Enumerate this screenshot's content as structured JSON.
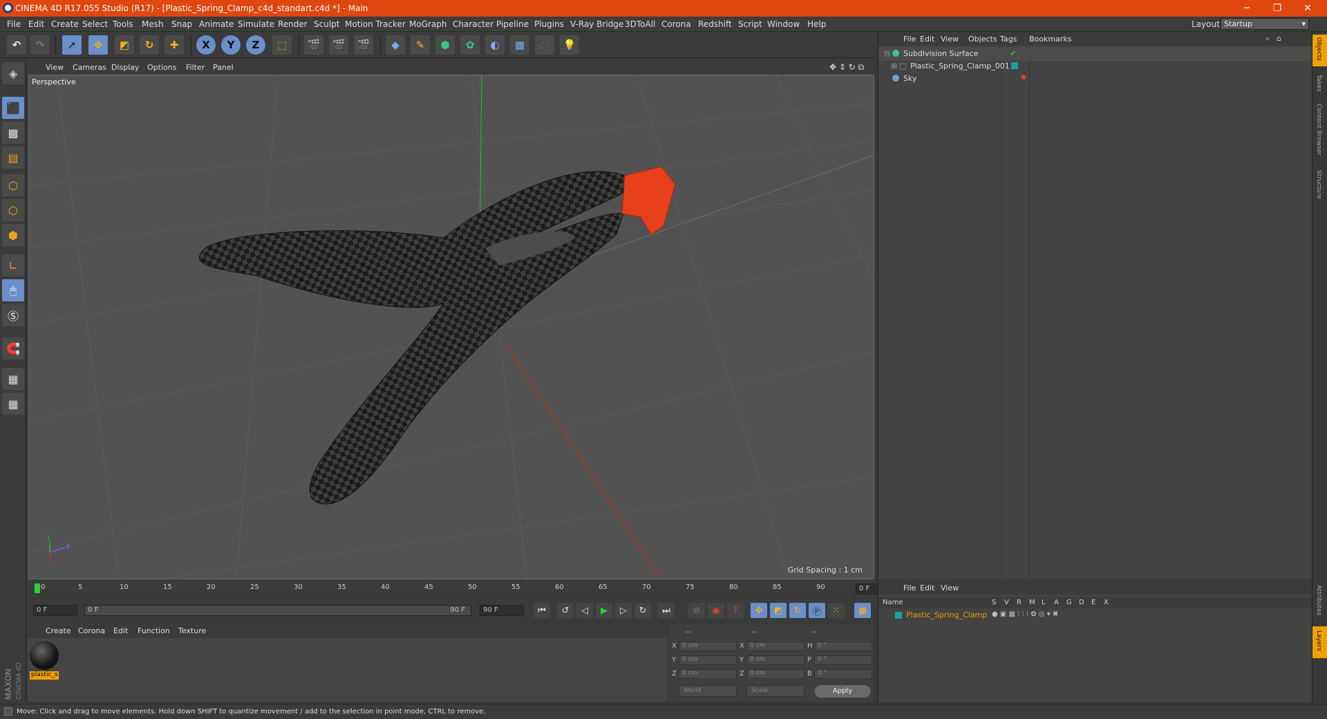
{
  "window": {
    "title": "CINEMA 4D R17.055 Studio (R17) - [Plastic_Spring_Clamp_c4d_standart.c4d *] - Main",
    "min_label": "─",
    "max_label": "❐",
    "close_label": "✕"
  },
  "menubar": {
    "items": [
      "File",
      "Edit",
      "Create",
      "Select",
      "Tools",
      "Mesh",
      "Snap",
      "Animate",
      "Simulate",
      "Render",
      "Sculpt",
      "Motion Tracker",
      "MoGraph",
      "Character",
      "Pipeline",
      "Plugins",
      "V-Ray Bridge",
      "3DToAll",
      "Corona",
      "Redshift",
      "Script",
      "Window",
      "Help"
    ],
    "layout_label": "Layout:",
    "layout_value": "Startup"
  },
  "toolbar": {
    "axis_x": "X",
    "axis_y": "Y",
    "axis_z": "Z"
  },
  "viewport": {
    "menu": [
      "View",
      "Cameras",
      "Display",
      "Options",
      "Filter",
      "Panel"
    ],
    "camera_label": "Perspective",
    "grid_spacing": "Grid Spacing : 1 cm",
    "axis_labels": {
      "x": "x",
      "y": "y",
      "z": "z"
    }
  },
  "timeline": {
    "ticks": [
      "0",
      "5",
      "10",
      "15",
      "20",
      "25",
      "30",
      "35",
      "40",
      "45",
      "50",
      "55",
      "60",
      "65",
      "70",
      "75",
      "80",
      "85",
      "90"
    ],
    "current_frame": "0 F",
    "start_frame": "0 F",
    "range_start": "0 F",
    "range_end": "90 F",
    "end_frame": "90 F"
  },
  "material_manager": {
    "menu": [
      "Create",
      "Corona",
      "Edit",
      "Function",
      "Texture"
    ],
    "materials": [
      {
        "name": "plastic_s"
      }
    ]
  },
  "coordinates": {
    "headers": [
      "--",
      "--",
      "--"
    ],
    "rows": [
      {
        "l1": "X",
        "v1": "0 cm",
        "l2": "X",
        "v2": "0 cm",
        "l3": "H",
        "v3": "0 °"
      },
      {
        "l1": "Y",
        "v1": "0 cm",
        "l2": "Y",
        "v2": "0 cm",
        "l3": "P",
        "v3": "0 °"
      },
      {
        "l1": "Z",
        "v1": "0 cm",
        "l2": "Z",
        "v2": "0 cm",
        "l3": "B",
        "v3": "0 °"
      }
    ],
    "mode": "World",
    "size_mode": "Scale",
    "apply_label": "Apply"
  },
  "object_manager": {
    "menu": [
      "File",
      "Edit",
      "View",
      "Objects",
      "Tags",
      "Bookmarks"
    ],
    "objects": [
      {
        "name": "Subdivision Surface",
        "color": "#3ec58a"
      },
      {
        "name": "Plastic_Spring_Clamp_001",
        "color": "#cccccc"
      },
      {
        "name": "Sky",
        "color": "#6fa0d8"
      }
    ]
  },
  "layer_manager": {
    "menu": [
      "File",
      "Edit",
      "View"
    ],
    "header_name": "Name",
    "header_cols": [
      "S",
      "V",
      "R",
      "M",
      "L",
      "A",
      "G",
      "D",
      "E",
      "X"
    ],
    "layers": [
      {
        "name": "Plastic_Spring_Clamp",
        "color": "#1aa0a0"
      }
    ]
  },
  "right_tabs": [
    "Objects",
    "Takes",
    "Content Browser",
    "Structure",
    "Attributes",
    "Layers"
  ],
  "brand": {
    "line1": "MAXON",
    "line2": "CINEMA 4D"
  },
  "status": "Move: Click and drag to move elements. Hold down SHIFT to quantize movement / add to the selection in point mode, CTRL to remove.",
  "colors": {
    "titlebar": "#e0460f",
    "accent": "#6a8fc9",
    "selection": "#f0a000",
    "clamp_tip": "#e8401a"
  }
}
